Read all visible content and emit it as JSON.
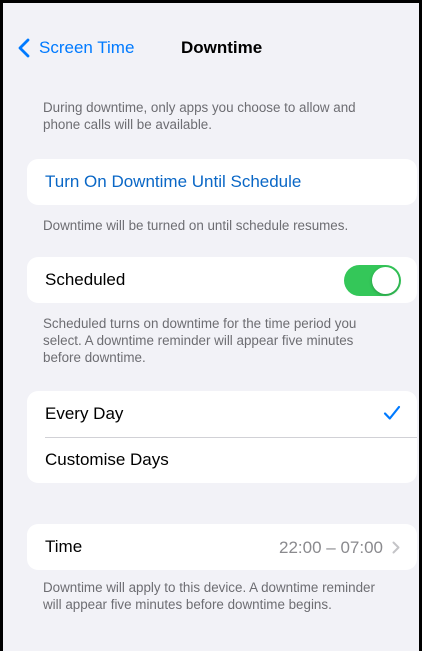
{
  "nav": {
    "back_label": "Screen Time",
    "title": "Downtime"
  },
  "intro_footnote": "During downtime, only apps you choose to allow and phone calls will be available.",
  "turn_on": {
    "label": "Turn On Downtime Until Schedule",
    "footnote": "Downtime will be turned on until schedule resumes."
  },
  "scheduled": {
    "label": "Scheduled",
    "enabled": true,
    "footnote": "Scheduled turns on downtime for the time period you select. A downtime reminder will appear five minutes before downtime."
  },
  "days": {
    "options": [
      {
        "label": "Every Day",
        "selected": true
      },
      {
        "label": "Customise Days",
        "selected": false
      }
    ]
  },
  "time": {
    "label": "Time",
    "value": "22:00 – 07:00",
    "footnote": "Downtime will apply to this device. A downtime reminder will appear five minutes before downtime begins."
  },
  "colors": {
    "accent": "#007aff",
    "toggle_on": "#34c759",
    "background": "#f2f2f7"
  }
}
